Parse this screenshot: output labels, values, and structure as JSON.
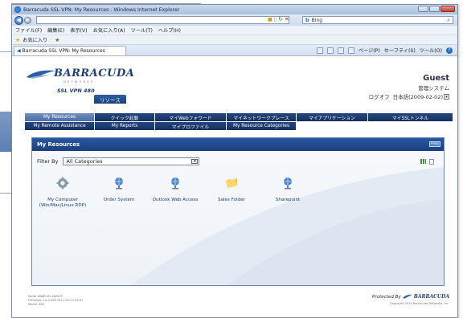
{
  "browser": {
    "title": "Barracuda SSL VPN: My Resources - Windows Internet Explorer",
    "address_url": "",
    "search_engine": "Bing",
    "menu": [
      "ファイル(F)",
      "編集(E)",
      "表示(V)",
      "お気に入り(A)",
      "ツール(T)",
      "ヘルプ(H)"
    ],
    "favorites_label": "お気に入り",
    "tab_label": "Barracuda SSL VPN: My Resources",
    "commands": [
      "ページ(P)",
      "セーフティ(S)",
      "ツール(O)"
    ]
  },
  "header": {
    "logo_text": "BARRACUDA",
    "logo_sub": "NETWORKS",
    "logo_model": "SSL VPN 480",
    "section_badge": "リソース",
    "user_name": "Guest",
    "user_system": "管理システム",
    "logout_label": "ログオフ",
    "language_label": "日本語(2009-02-02)"
  },
  "nav": {
    "row1": [
      "My Resources",
      "クイック起動",
      "マイWebフォワード",
      "マイネットワークプレース",
      "マイアプリケーション",
      "マイSSLトンネル"
    ],
    "row2": [
      "My Remote Assistance",
      "My Reports",
      "マイプロファイル",
      "My Resource Categories"
    ]
  },
  "panel": {
    "title": "My Resources",
    "help_label": "Help",
    "filter_label": "Filter By",
    "filter_value": "All Categories"
  },
  "resources": [
    {
      "label": "My Computer (Win/Mac/Linux RDP)",
      "icon": "gear-computer-icon"
    },
    {
      "label": "Order System",
      "icon": "globe-web-icon"
    },
    {
      "label": "Outlook Web Access",
      "icon": "globe-web-icon"
    },
    {
      "label": "Sales Folder",
      "icon": "folder-icon"
    },
    {
      "label": "Sharepoint",
      "icon": "globe-web-icon"
    }
  ],
  "footer": {
    "serial": "Serial #BAR-VD-180025",
    "firmware": "Firmware 2.0.0.028 2011-03-23 09:41",
    "model": "Model: 480",
    "protected_label": "Protected By",
    "protected_brand": "BARRACUDA",
    "copyright": "Copyright 2011 Barracuda Networks, Inc."
  },
  "colors": {
    "navy": "#1a3f78",
    "nav_active": "#5677ad",
    "link_blue": "#1b3c73"
  }
}
